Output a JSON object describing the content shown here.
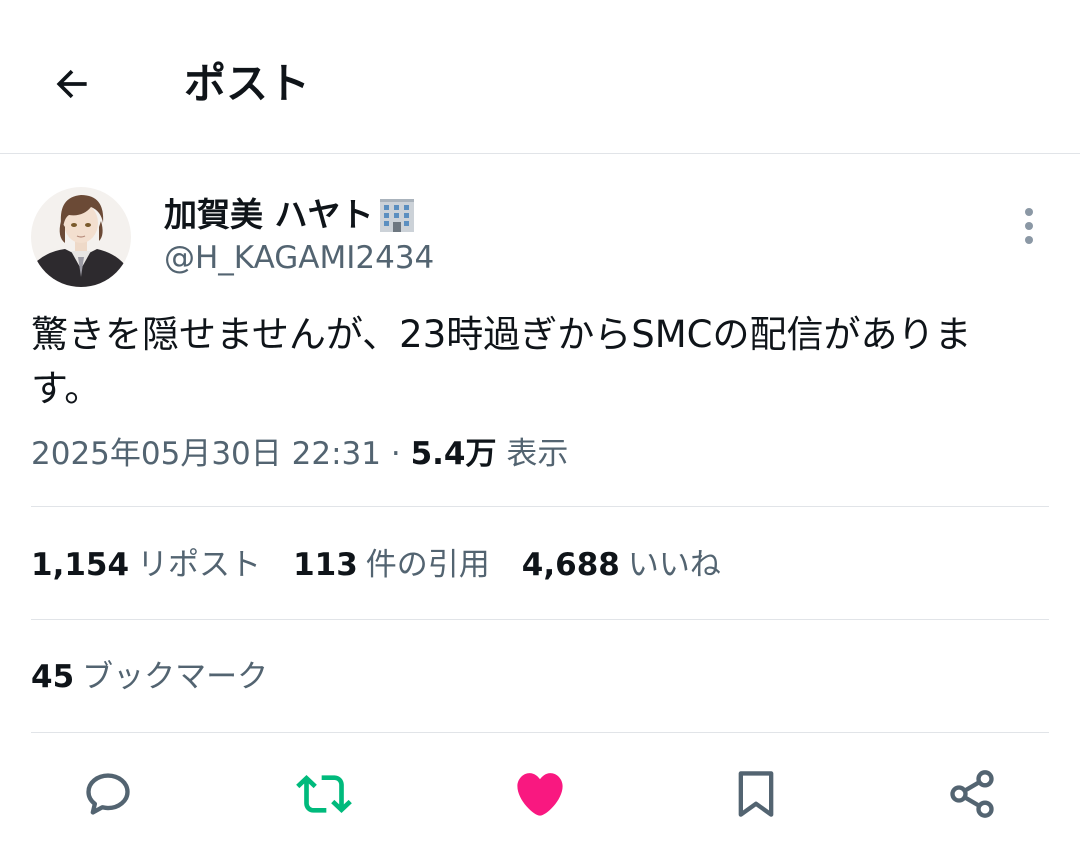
{
  "header": {
    "title": "ポスト"
  },
  "post": {
    "author": {
      "display_name": "加賀美 ハヤト",
      "handle": "@H_KAGAMI2434",
      "badge_icon": "office-building-icon"
    },
    "text": "驚きを隠せませんが、23時過ぎからSMCの配信があります。",
    "timestamp": "2025年05月30日 22:31",
    "separator": "·",
    "views_count": "5.4万",
    "views_label": "表示"
  },
  "stats": {
    "reposts_count": "1,154",
    "reposts_label": "リポスト",
    "quotes_count": "113",
    "quotes_label": "件の引用",
    "likes_count": "4,688",
    "likes_label": "いいね",
    "bookmarks_count": "45",
    "bookmarks_label": "ブックマーク"
  },
  "actions": {
    "reply_icon": "reply-icon",
    "repost_icon": "repost-icon",
    "like_icon": "like-heart-icon",
    "bookmark_icon": "bookmark-icon",
    "share_icon": "share-icon"
  },
  "colors": {
    "text_primary": "#0f1419",
    "text_secondary": "#536471",
    "divider": "#e1e4e8",
    "repost_active": "#00ba7c",
    "like_active": "#f91880",
    "icon_default": "#536471"
  }
}
